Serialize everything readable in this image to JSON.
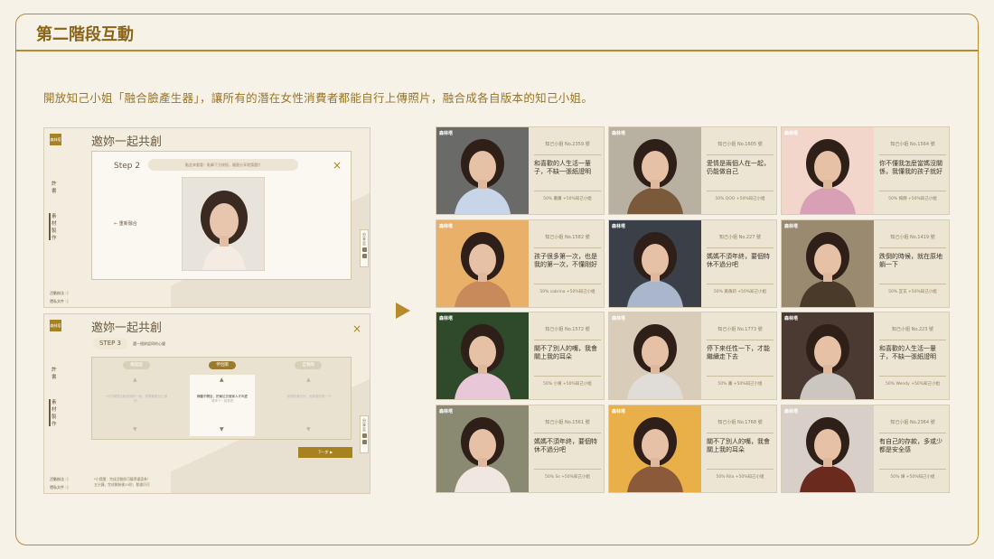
{
  "title": "第二階段互動",
  "intro": "開放知己小姐「融合臉產生器」，讓所有的潛在女性消費者都能自行上傳照片，融合成各自版本的知己小姐。",
  "mock1": {
    "logo": "森林塔",
    "title": "邀妳一起共創",
    "side_top": "許\n書",
    "side_mid": "素\n材\n製\n作",
    "foot1": "活動辦法 ⓘ",
    "foot2": "隱私文件 ⓘ",
    "step": "Step 2",
    "hint": "點此來看看！點擊下方按鈕，複層分享就請選片",
    "back": "← 重新融合",
    "social": "分\n享\n至"
  },
  "mock2": {
    "logo": "森林塔",
    "title": "邀妳一起共創",
    "side_top": "許\n書",
    "side_mid": "素\n材\n製\n作",
    "foot1": "活動辦法 ⓘ",
    "foot2": "隱私文件 ⓘ",
    "step": "STEP 3",
    "step_sub": "選一個妳認同的心聲",
    "tags": [
      "獨當面",
      "伴侶關",
      "自我關"
    ],
    "opt_left": "一向不願意比較低調的一面，需要都是自己選好",
    "opt_mid": "靜聽不開自，把東位去做家人才叫愛",
    "opt_mid_sub": "選擇下一篇看看",
    "opt_right": "我想知道些好，就算當的是一下",
    "next": "下一步 ▶",
    "note": "*小提醒：完成活動即可獲得優惠券！\n五分鐘，完成開始後10秒，動畫仍可"
  },
  "tiles": [
    {
      "brand": "森林塔",
      "no": "知己小姐 No.2359 號",
      "quote": "和喜歡的人生活一輩子，不缺一張紙證明",
      "credit": "50% 蕭蕭 +50%知己小姐"
    },
    {
      "brand": "森林塔",
      "no": "知己小姐 No.1605 號",
      "quote": "愛情是兩個人在一起，仍能做自己",
      "credit": "50% QOO +50%知己小姐"
    },
    {
      "brand": "森林塔",
      "no": "知己小姐 No.1564 號",
      "quote": "你不懂我怎麼當媽沒關係，我懂我的孩子就好",
      "credit": "50% 楊靜 +50%知己小姐"
    },
    {
      "brand": "森林塔",
      "no": "知己小姐 No.1582 號",
      "quote": "孩子很多第一次，也是我的第一次，不懂剛好",
      "credit": "50% sabrina +50%知己小姐"
    },
    {
      "brand": "森林塔",
      "no": "知己小姐 No.227 號",
      "quote": "媽媽不須年終，要個特休不過分吧",
      "credit": "50% 黃蒨莉 +50%知己小姐"
    },
    {
      "brand": "森林塔",
      "no": "知己小姐 No.1419 號",
      "quote": "跌倒的時候，就在原地躺一下",
      "credit": "50% 宜玄 +50%知己小姐"
    },
    {
      "brand": "森林塔",
      "no": "知己小姐 No.1572 號",
      "quote": "關不了別人的嘴，我會關上我的耳朵",
      "credit": "50% 小黃 +50%知己小姐"
    },
    {
      "brand": "森林塔",
      "no": "知己小姐 No.1773 號",
      "quote": "停下來任性一下，才能繼續走下去",
      "credit": "50% 蕭 +50%知己小姐"
    },
    {
      "brand": "森林塔",
      "no": "知己小姐 No.223 號",
      "quote": "和喜歡的人生活一輩子，不缺一張紙證明",
      "credit": "50% Wendy +50%知己小姐"
    },
    {
      "brand": "森林塔",
      "no": "知己小姐 No.1561 號",
      "quote": "媽媽不須年終，要個特休不過分吧",
      "credit": "50% Ss +50%知己小姐"
    },
    {
      "brand": "森林塔",
      "no": "知己小姐 No.1768 號",
      "quote": "關不了別人的嘴，我會關上我的耳朵",
      "credit": "50% Rila +50%知己小姐"
    },
    {
      "brand": "森林塔",
      "no": "知己小姐 No.2364 號",
      "quote": "有自己的存款，多或少都是安全感",
      "credit": "50% 燁 +50%知己小姐"
    }
  ],
  "colors": {
    "accent": "#b88a2e",
    "brand": "#a8821f",
    "bg": "#f7f2e8"
  }
}
